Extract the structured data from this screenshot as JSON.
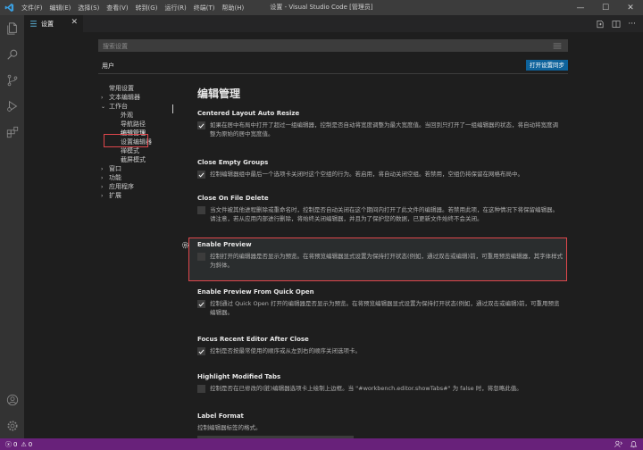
{
  "titlebar": {
    "title": "设置 - Visual Studio Code [管理员]",
    "menus": [
      "文件(F)",
      "编辑(E)",
      "选择(S)",
      "查看(V)",
      "转到(G)",
      "运行(R)",
      "终端(T)",
      "帮助(H)"
    ]
  },
  "tab": {
    "label": "设置"
  },
  "search": {
    "placeholder": "搜索设置"
  },
  "scope": {
    "user_tab": "用户",
    "sync_button": "打开设置同步"
  },
  "toc": [
    {
      "label": "常用设置",
      "chevron": "",
      "level": 0
    },
    {
      "label": "文本编辑器",
      "chevron": "›",
      "level": 0
    },
    {
      "label": "工作台",
      "chevron": "⌄",
      "level": 0
    },
    {
      "label": "外观",
      "chevron": "",
      "level": 1
    },
    {
      "label": "导航路径",
      "chevron": "",
      "level": 1
    },
    {
      "label": "编辑管理",
      "chevron": "",
      "level": 1
    },
    {
      "label": "设置编辑器",
      "chevron": "",
      "level": 1
    },
    {
      "label": "禅模式",
      "chevron": "",
      "level": 1
    },
    {
      "label": "截屏模式",
      "chevron": "",
      "level": 1
    },
    {
      "label": "窗口",
      "chevron": "›",
      "level": 0
    },
    {
      "label": "功能",
      "chevron": "›",
      "level": 0
    },
    {
      "label": "应用程序",
      "chevron": "›",
      "level": 0
    },
    {
      "label": "扩展",
      "chevron": "›",
      "level": 0
    }
  ],
  "main": {
    "title": "编辑管理",
    "settings": [
      {
        "title": "Centered Layout Auto Resize",
        "checked": true,
        "desc": "如果在居中布局中打开了超过一组编辑器，控制是否自动将宽度调整为最大宽度值。当回到只打开了一组编辑器的状态，将自动将宽度调整为原始的居中宽度值。"
      },
      {
        "title": "Close Empty Groups",
        "checked": true,
        "desc": "控制编辑器组中最后一个选项卡关闭时这个空组的行为。若启用，将自动关闭空组。若禁用，空组仍将保留在网格布局中。"
      },
      {
        "title": "Close On File Delete",
        "checked": false,
        "desc": "当文件被其他进程删除或重命名时，控制是否自动关闭在这个期间内打开了此文件的编辑器。若禁用此项，在这种情况下将保留编辑器。请注意，若从应用内部进行删除，将始终关闭编辑器，并且为了保护您的数据，已更新文件始终不会关闭。"
      },
      {
        "title": "Enable Preview",
        "checked": false,
        "desc": "控制打开的编辑器是否显示为预览。在将预览编辑器显式设置为保持打开状态(例如，通过双击或编辑)前，可重用预览编辑器，其字体样式为斜体。"
      },
      {
        "title": "Enable Preview From Quick Open",
        "checked": true,
        "desc": "控制通过 Quick Open 打开的编辑器是否显示为预览。在将预览编辑器显式设置为保持打开状态(例如，通过双击或编辑)前，可重用预览编辑器。"
      },
      {
        "title": "Focus Recent Editor After Close",
        "checked": true,
        "desc": "控制是否按最常使用的顺序或从左到右的顺序关闭选项卡。"
      },
      {
        "title": "Highlight Modified Tabs",
        "checked": false,
        "desc": "控制是否在已修改的(脏)编辑器选项卡上绘制上边框。当 \"#workbench.editor.showTabs#\" 为 false 时，将忽略此值。"
      },
      {
        "title": "Label Format",
        "checked": null,
        "desc": "控制编辑器标签的格式。"
      }
    ]
  },
  "statusbar": {
    "errors": "0",
    "warnings": "0"
  },
  "colors": {
    "statusbar": "#68217a",
    "accent": "#0e639c",
    "highlight": "#e0474c"
  }
}
